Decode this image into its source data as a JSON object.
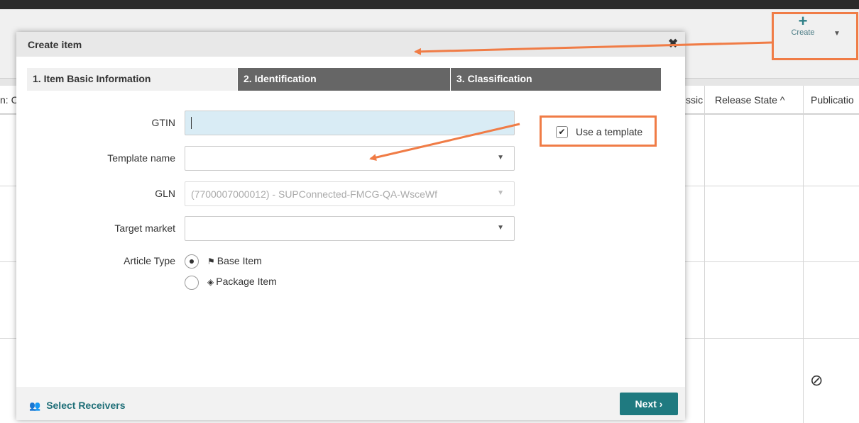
{
  "background": {
    "create_label": "Create",
    "columns": [
      "n: C",
      "ssic",
      "Release State ^",
      "Publicatio"
    ]
  },
  "modal": {
    "title": "Create item",
    "tabs": [
      {
        "label": "1. Item Basic Information",
        "active": true
      },
      {
        "label": "2. Identification",
        "active": false
      },
      {
        "label": "3. Classification",
        "active": false
      }
    ],
    "fields": {
      "gtin": {
        "label": "GTIN",
        "value": ""
      },
      "template_name": {
        "label": "Template name",
        "value": ""
      },
      "gln": {
        "label": "GLN",
        "value": "(7700007000012) - SUPConnected-FMCG-QA-WsceWf",
        "disabled": true
      },
      "target_market": {
        "label": "Target market",
        "value": ""
      }
    },
    "use_template": {
      "label": "Use a template",
      "checked": true
    },
    "article_type": {
      "label": "Article Type",
      "options": [
        {
          "label": "Base Item",
          "icon": "flag-icon",
          "selected": true
        },
        {
          "label": "Package Item",
          "icon": "box-icon",
          "selected": false
        }
      ]
    },
    "footer": {
      "select_receivers": "Select Receivers",
      "next": "Next ›"
    }
  },
  "colors": {
    "accent": "#1f7a80",
    "annotation": "#f07c46",
    "tab_inactive": "#666666",
    "gtin_focus": "#d9ecf5"
  }
}
